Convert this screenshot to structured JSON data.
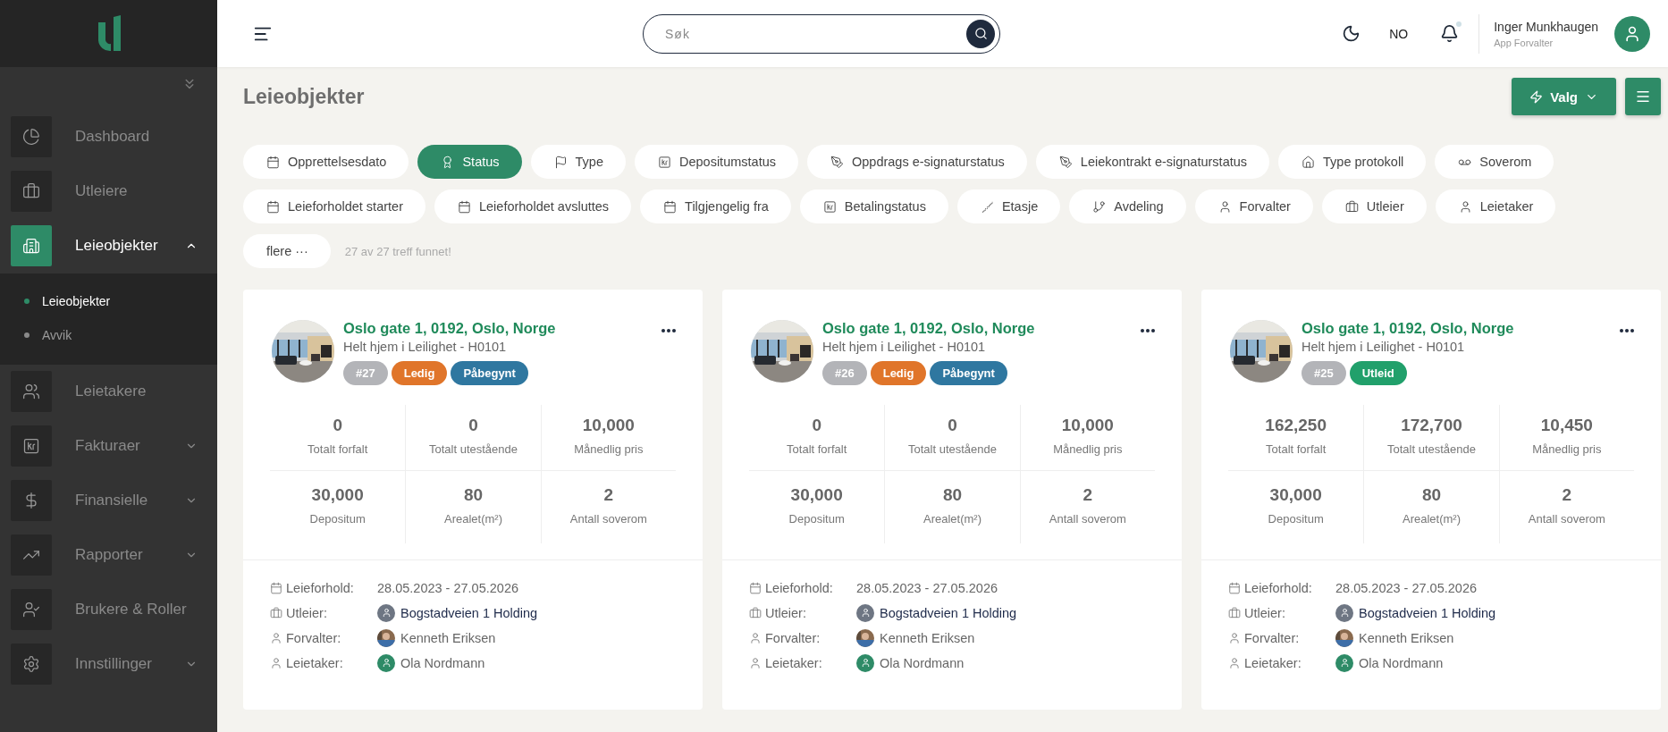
{
  "sidebar": {
    "items": [
      {
        "label": "Dashboard",
        "kind": "pie",
        "selected": false
      },
      {
        "label": "Utleiere",
        "kind": "briefcase",
        "selected": false
      },
      {
        "label": "Leieobjekter",
        "kind": "building",
        "selected": true,
        "expanded": true,
        "children": [
          {
            "label": "Leieobjekter",
            "selected": true
          },
          {
            "label": "Avvik",
            "selected": false
          }
        ]
      },
      {
        "label": "Leietakere",
        "kind": "users",
        "selected": false
      },
      {
        "label": "Fakturaer",
        "kind": "kr",
        "selected": false,
        "expanded": false
      },
      {
        "label": "Finansielle",
        "kind": "dollar",
        "selected": false,
        "expanded": false
      },
      {
        "label": "Rapporter",
        "kind": "trend",
        "selected": false,
        "expanded": false
      },
      {
        "label": "Brukere & Roller",
        "kind": "usercheck",
        "selected": false
      },
      {
        "label": "Innstillinger",
        "kind": "settings",
        "selected": false,
        "expanded": false
      }
    ]
  },
  "topbar": {
    "search": {
      "placeholder": "Søk"
    },
    "language": "NO",
    "notification_dot": true,
    "user": {
      "name": "Inger Munkhaugen",
      "role": "App Forvalter"
    }
  },
  "page": {
    "title": "Leieobjekter",
    "actions": [
      {
        "label": "Valg",
        "kind": "menu"
      }
    ]
  },
  "filters": [
    {
      "label": "Opprettelsesdato",
      "kind": "calendar",
      "selected": false
    },
    {
      "label": "Status",
      "kind": "award",
      "selected": true
    },
    {
      "label": "Type",
      "kind": "flag",
      "selected": false
    },
    {
      "label": "Depositumstatus",
      "kind": "kr",
      "selected": false
    },
    {
      "label": "Oppdrags e-signaturstatus",
      "kind": "pen",
      "selected": false
    },
    {
      "label": "Leiekontrakt e-signaturstatus",
      "kind": "pen",
      "selected": false
    },
    {
      "label": "Type protokoll",
      "kind": "house",
      "selected": false
    },
    {
      "label": "Soverom",
      "kind": "bed",
      "selected": false
    },
    {
      "label": "Leieforholdet starter",
      "kind": "calendar",
      "selected": false
    },
    {
      "label": "Leieforholdet avsluttes",
      "kind": "calendar",
      "selected": false
    },
    {
      "label": "Tilgjengelig fra",
      "kind": "calendar",
      "selected": false
    },
    {
      "label": "Betalingstatus",
      "kind": "kr",
      "selected": false
    },
    {
      "label": "Etasje",
      "kind": "stairs",
      "selected": false
    },
    {
      "label": "Avdeling",
      "kind": "branch",
      "selected": false
    },
    {
      "label": "Forvalter",
      "kind": "user",
      "selected": false
    },
    {
      "label": "Utleier",
      "kind": "briefcase",
      "selected": false
    },
    {
      "label": "Leietaker",
      "kind": "user",
      "selected": false
    }
  ],
  "more": {
    "label": "flere ···"
  },
  "result_count": "27 av 27 treff funnet!",
  "cards": [
    {
      "title": "Oslo gate 1, 0192, Oslo, Norge",
      "subtitle": "Helt hjem i Leilighet - H0101",
      "tags": [
        {
          "label": "#27",
          "color": "#b3b4b8"
        },
        {
          "label": "Ledig",
          "color": "#e0752a"
        },
        {
          "label": "Påbegynt",
          "color": "#2f77a0"
        }
      ],
      "stats": [
        {
          "value": "0",
          "label": "Totalt forfalt"
        },
        {
          "value": "0",
          "label": "Totalt utestående"
        },
        {
          "value": "10,000",
          "label": "Månedlig pris"
        },
        {
          "value": "30,000",
          "label": "Depositum"
        },
        {
          "value": "80",
          "label": "Arealet(m²)"
        },
        {
          "value": "2",
          "label": "Antall soverom"
        }
      ],
      "details": [
        {
          "kind": "calendar",
          "label": "Leieforhold:",
          "value": "28.05.2023 - 27.05.2026"
        },
        {
          "kind": "briefcase",
          "label": "Utleier:",
          "value": "Bogstadveien 1 Holding",
          "avatar": {
            "kind": "icon",
            "color": "#6e7683"
          },
          "link": true
        },
        {
          "kind": "user",
          "label": "Forvalter:",
          "value": "Kenneth Eriksen",
          "link": false
        },
        {
          "kind": "user",
          "label": "Leietaker:",
          "value": "Ola Nordmann",
          "avatar": {
            "kind": "icon",
            "color": "#2e8b67"
          },
          "link": false
        }
      ]
    },
    {
      "title": "Oslo gate 1, 0192, Oslo, Norge",
      "subtitle": "Helt hjem i Leilighet - H0101",
      "tags": [
        {
          "label": "#26",
          "color": "#b3b4b8"
        },
        {
          "label": "Ledig",
          "color": "#e0752a"
        },
        {
          "label": "Påbegynt",
          "color": "#2f77a0"
        }
      ],
      "stats": [
        {
          "value": "0",
          "label": "Totalt forfalt"
        },
        {
          "value": "0",
          "label": "Totalt utestående"
        },
        {
          "value": "10,000",
          "label": "Månedlig pris"
        },
        {
          "value": "30,000",
          "label": "Depositum"
        },
        {
          "value": "80",
          "label": "Arealet(m²)"
        },
        {
          "value": "2",
          "label": "Antall soverom"
        }
      ],
      "details": [
        {
          "kind": "calendar",
          "label": "Leieforhold:",
          "value": "28.05.2023 - 27.05.2026"
        },
        {
          "kind": "briefcase",
          "label": "Utleier:",
          "value": "Bogstadveien 1 Holding",
          "avatar": {
            "kind": "icon",
            "color": "#6e7683"
          },
          "link": true
        },
        {
          "kind": "user",
          "label": "Forvalter:",
          "value": "Kenneth Eriksen",
          "link": false
        },
        {
          "kind": "user",
          "label": "Leietaker:",
          "value": "Ola Nordmann",
          "avatar": {
            "kind": "icon",
            "color": "#2e8b67"
          },
          "link": false
        }
      ]
    },
    {
      "title": "Oslo gate 1, 0192, Oslo, Norge",
      "subtitle": "Helt hjem i Leilighet - H0101",
      "tags": [
        {
          "label": "#25",
          "color": "#b3b4b8"
        },
        {
          "label": "Utleid",
          "color": "#21a06b"
        }
      ],
      "stats": [
        {
          "value": "162,250",
          "label": "Totalt forfalt"
        },
        {
          "value": "172,700",
          "label": "Totalt utestående"
        },
        {
          "value": "10,450",
          "label": "Månedlig pris"
        },
        {
          "value": "30,000",
          "label": "Depositum"
        },
        {
          "value": "80",
          "label": "Arealet(m²)"
        },
        {
          "value": "2",
          "label": "Antall soverom"
        }
      ],
      "details": [
        {
          "kind": "calendar",
          "label": "Leieforhold:",
          "value": "28.05.2023 - 27.05.2026"
        },
        {
          "kind": "briefcase",
          "label": "Utleier:",
          "value": "Bogstadveien 1 Holding",
          "avatar": {
            "kind": "icon",
            "color": "#6e7683"
          },
          "link": true
        },
        {
          "kind": "user",
          "label": "Forvalter:",
          "value": "Kenneth Eriksen",
          "link": false
        },
        {
          "kind": "user",
          "label": "Leietaker:",
          "value": "Ola Nordmann",
          "avatar": {
            "kind": "icon",
            "color": "#2e8b67"
          },
          "link": false
        }
      ]
    }
  ]
}
